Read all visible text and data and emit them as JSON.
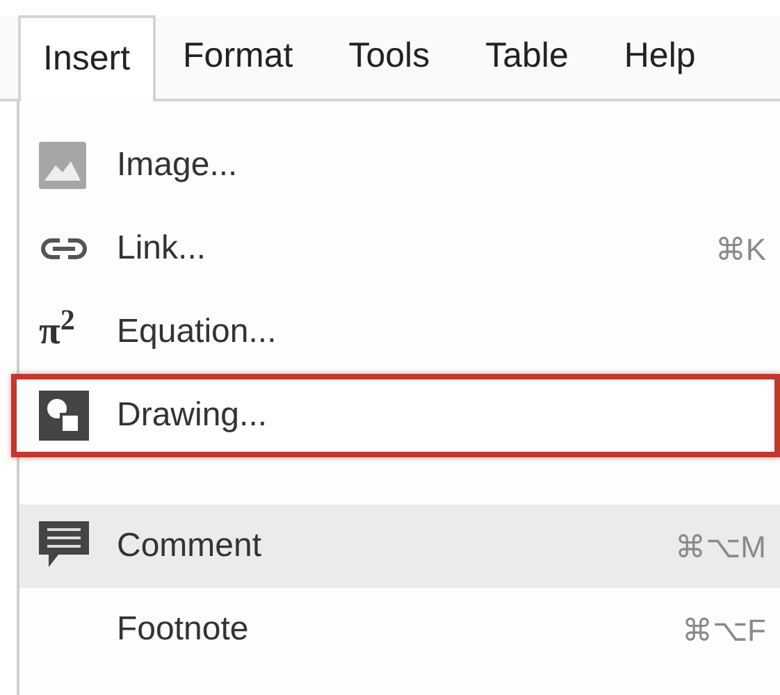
{
  "menu_bar": [
    {
      "label": "Insert",
      "selected": true
    },
    {
      "label": "Format",
      "selected": false
    },
    {
      "label": "Tools",
      "selected": false
    },
    {
      "label": "Table",
      "selected": false
    },
    {
      "label": "Help",
      "selected": false
    }
  ],
  "menu_items": [
    {
      "kind": "image",
      "label": "Image...",
      "highlighted": false,
      "outlined": false
    },
    {
      "kind": "link",
      "label": "Link...",
      "shortcut": "⌘K",
      "highlighted": false,
      "outlined": false
    },
    {
      "kind": "equation",
      "glyph": "π$^{2}$",
      "label": "Equation...",
      "highlighted": false,
      "outlined": false
    },
    {
      "kind": "drawing",
      "label": "Drawing...",
      "highlighted": false,
      "outlined": true
    },
    {
      "kind": "separator"
    },
    {
      "kind": "comment",
      "label": "Comment",
      "shortcut": "⌘⌥M",
      "highlighted": true,
      "outlined": false
    },
    {
      "kind": "plain",
      "label": "Footnote",
      "shortcut": "⌘⌥F",
      "highlighted": false,
      "outlined": false
    }
  ]
}
